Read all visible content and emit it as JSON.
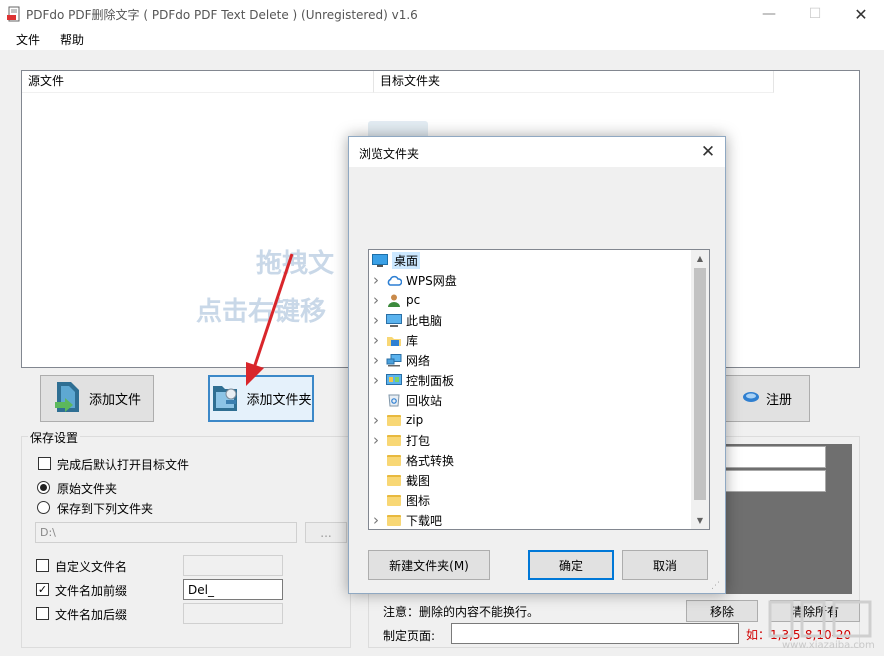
{
  "window": {
    "title": "PDFdo PDF删除文字 ( PDFdo PDF Text Delete ) (Unregistered) v1.6"
  },
  "menu": {
    "items": [
      "文件",
      "帮助"
    ]
  },
  "file_list": {
    "columns": [
      "源文件",
      "目标文件夹"
    ],
    "hint_line1": "拖拽文",
    "hint_line2": "点击右键移"
  },
  "buttons": {
    "add_file": "添加文件",
    "add_folder": "添加文件夹",
    "register": "注册"
  },
  "save_settings": {
    "legend": "保存设置",
    "open_after": {
      "label": "完成后默认打开目标文件",
      "checked": false
    },
    "original_folder": {
      "label": "原始文件夹",
      "selected": true
    },
    "save_to": {
      "label": "保存到下列文件夹",
      "selected": false
    },
    "path_value": "D:\\",
    "browse_label": "...",
    "custom_name": {
      "label": "自定义文件名",
      "checked": false
    },
    "prefix": {
      "label": "文件名加前缀",
      "checked": true,
      "value": "Del_"
    },
    "suffix": {
      "label": "文件名加后缀",
      "checked": false
    }
  },
  "right_panel": {
    "note": "注意：删除的内容不能换行。",
    "remove_label": "移除",
    "clear_label": "清除所有",
    "pages_label": "制定页面:",
    "pages_example": "如：1,3,5-8,10-20"
  },
  "dialog": {
    "title": "浏览文件夹",
    "tree": [
      {
        "label": "桌面",
        "icon": "desktop-icon",
        "expandable": false,
        "indent": 0,
        "selected": true
      },
      {
        "label": "WPS网盘",
        "icon": "cloud-icon",
        "expandable": true,
        "indent": 1
      },
      {
        "label": "pc",
        "icon": "user-icon",
        "expandable": true,
        "indent": 1
      },
      {
        "label": "此电脑",
        "icon": "computer-icon",
        "expandable": true,
        "indent": 1
      },
      {
        "label": "库",
        "icon": "library-icon",
        "expandable": true,
        "indent": 1
      },
      {
        "label": "网络",
        "icon": "network-icon",
        "expandable": true,
        "indent": 1
      },
      {
        "label": "控制面板",
        "icon": "control-panel-icon",
        "expandable": true,
        "indent": 1
      },
      {
        "label": "回收站",
        "icon": "recycle-bin-icon",
        "expandable": false,
        "indent": 1
      },
      {
        "label": "zip",
        "icon": "folder-icon",
        "expandable": true,
        "indent": 1
      },
      {
        "label": "打包",
        "icon": "folder-icon",
        "expandable": true,
        "indent": 1
      },
      {
        "label": "格式转换",
        "icon": "folder-icon",
        "expandable": false,
        "indent": 1
      },
      {
        "label": "截图",
        "icon": "folder-icon",
        "expandable": false,
        "indent": 1
      },
      {
        "label": "图标",
        "icon": "folder-icon",
        "expandable": false,
        "indent": 1
      },
      {
        "label": "下载吧",
        "icon": "folder-icon",
        "expandable": true,
        "indent": 1
      }
    ],
    "new_folder_label": "新建文件夹(M)",
    "ok_label": "确定",
    "cancel_label": "取消"
  },
  "watermark": {
    "text": "www.xiazaiba.com"
  },
  "colors": {
    "accent": "#0078d7",
    "arrow": "#d9262b",
    "selection": "#cce8ff"
  }
}
